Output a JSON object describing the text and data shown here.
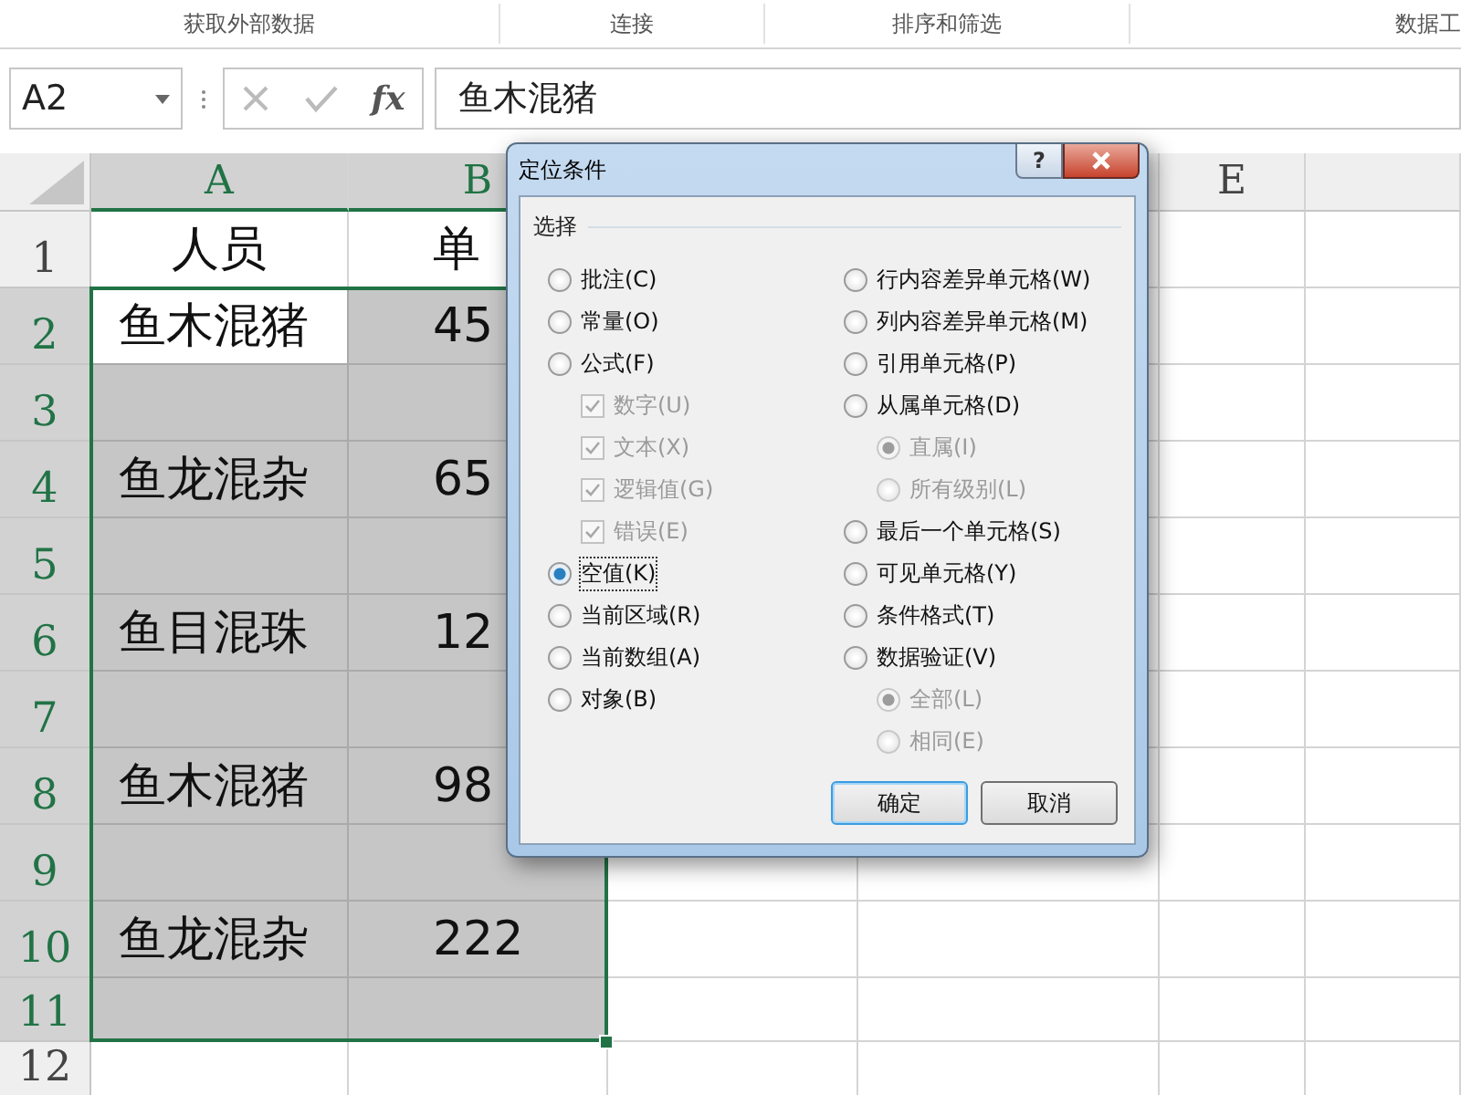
{
  "ribbon_groups": [
    "获取外部数据",
    "连接",
    "排序和筛选",
    "数据工"
  ],
  "name_box": "A2",
  "formula_buttons": [
    "fx"
  ],
  "formula": "鱼木混猪",
  "column_headers": [
    {
      "label": "A",
      "selected": true
    },
    {
      "label": "B",
      "selected": true
    },
    {
      "label": "E",
      "selected": false
    }
  ],
  "rows": [
    {
      "number": "1",
      "selected": false,
      "cells": [
        {
          "text": "人员",
          "selected": false
        },
        {
          "text": "单",
          "selected": false
        }
      ]
    },
    {
      "number": "2",
      "selected": true,
      "cells": [
        {
          "text": "鱼木混猪",
          "selected": true,
          "active": true
        },
        {
          "text": "45",
          "selected": true
        }
      ]
    },
    {
      "number": "3",
      "selected": true,
      "cells": [
        {
          "selected": true,
          "active": false
        },
        {
          "selected": true,
          "active": false
        }
      ]
    },
    {
      "number": "4",
      "selected": true,
      "cells": [
        {
          "text": "鱼龙混杂",
          "selected": true,
          "active": false
        },
        {
          "text": "65",
          "selected": true,
          "active": false
        }
      ]
    },
    {
      "number": "5",
      "selected": true,
      "cells": [
        {
          "selected": true,
          "active": false
        },
        {
          "selected": true,
          "active": false
        }
      ]
    },
    {
      "number": "6",
      "selected": true,
      "cells": [
        {
          "text": "鱼目混珠",
          "selected": true,
          "active": false
        },
        {
          "text": "12",
          "selected": true,
          "active": false
        }
      ]
    },
    {
      "number": "7",
      "selected": true,
      "cells": [
        {
          "selected": true,
          "active": false
        },
        {
          "selected": true,
          "active": false
        }
      ]
    },
    {
      "number": "8",
      "selected": true,
      "cells": [
        {
          "text": "鱼木混猪",
          "selected": true,
          "active": false
        },
        {
          "text": "98",
          "selected": true,
          "active": false
        }
      ]
    },
    {
      "number": "9",
      "selected": true,
      "cells": [
        {
          "selected": true,
          "active": false
        },
        {
          "selected": true,
          "active": false
        }
      ]
    },
    {
      "number": "10",
      "selected": true,
      "cells": [
        {
          "text": "鱼龙混杂",
          "selected": true,
          "active": false
        },
        {
          "text": "222",
          "selected": true,
          "active": false
        }
      ]
    },
    {
      "number": "11",
      "selected": true,
      "cells": [
        {
          "selected": true,
          "active": false
        },
        {
          "selected": true,
          "active": false
        }
      ]
    },
    {
      "number": "12",
      "selected": false,
      "cells": [
        {
          "selected": false
        },
        {
          "selected": false
        }
      ]
    }
  ],
  "dialog": {
    "title": "定位条件",
    "help": "?",
    "group_label": "选择",
    "left": [
      {
        "kind": "radio",
        "label": "批注(C)",
        "selected": false,
        "disabled": false
      },
      {
        "kind": "radio",
        "label": "常量(O)",
        "selected": false,
        "disabled": false
      },
      {
        "kind": "radio",
        "label": "公式(F)",
        "selected": false,
        "disabled": false,
        "children": [
          {
            "kind": "checkbox",
            "label": "数字(U)",
            "checked": true,
            "disabled": true
          },
          {
            "kind": "checkbox",
            "label": "文本(X)",
            "checked": true,
            "disabled": true
          },
          {
            "kind": "checkbox",
            "label": "逻辑值(G)",
            "checked": true,
            "disabled": true
          },
          {
            "kind": "checkbox",
            "label": "错误(E)",
            "checked": true,
            "disabled": true
          }
        ]
      },
      {
        "kind": "radio",
        "label": "空值(K)",
        "selected": true,
        "disabled": false
      },
      {
        "kind": "radio",
        "label": "当前区域(R)",
        "selected": false,
        "disabled": false
      },
      {
        "kind": "radio",
        "label": "当前数组(A)",
        "selected": false,
        "disabled": false
      },
      {
        "kind": "radio",
        "label": "对象(B)",
        "selected": false,
        "disabled": false
      }
    ],
    "right": [
      {
        "kind": "radio",
        "label": "行内容差异单元格(W)",
        "selected": false,
        "disabled": false
      },
      {
        "kind": "radio",
        "label": "列内容差异单元格(M)",
        "selected": false,
        "disabled": false
      },
      {
        "kind": "radio",
        "label": "引用单元格(P)",
        "selected": false,
        "disabled": false
      },
      {
        "kind": "radio",
        "label": "从属单元格(D)",
        "selected": false,
        "disabled": false,
        "children": [
          {
            "kind": "radio",
            "label": "直属(I)",
            "selected": true,
            "disabled": true
          },
          {
            "kind": "radio",
            "label": "所有级别(L)",
            "selected": false,
            "disabled": true
          }
        ]
      },
      {
        "kind": "radio",
        "label": "最后一个单元格(S)",
        "selected": false,
        "disabled": false
      },
      {
        "kind": "radio",
        "label": "可见单元格(Y)",
        "selected": false,
        "disabled": false
      },
      {
        "kind": "radio",
        "label": "条件格式(T)",
        "selected": false,
        "disabled": false
      },
      {
        "kind": "radio",
        "label": "数据验证(V)",
        "selected": false,
        "disabled": false,
        "children": [
          {
            "kind": "radio",
            "label": "全部(L)",
            "selected": true,
            "disabled": true
          },
          {
            "kind": "radio",
            "label": "相同(E)",
            "selected": false,
            "disabled": true
          }
        ]
      }
    ],
    "buttons": [
      {
        "label": "确定",
        "default": true
      },
      {
        "label": "取消",
        "default": false
      }
    ]
  }
}
